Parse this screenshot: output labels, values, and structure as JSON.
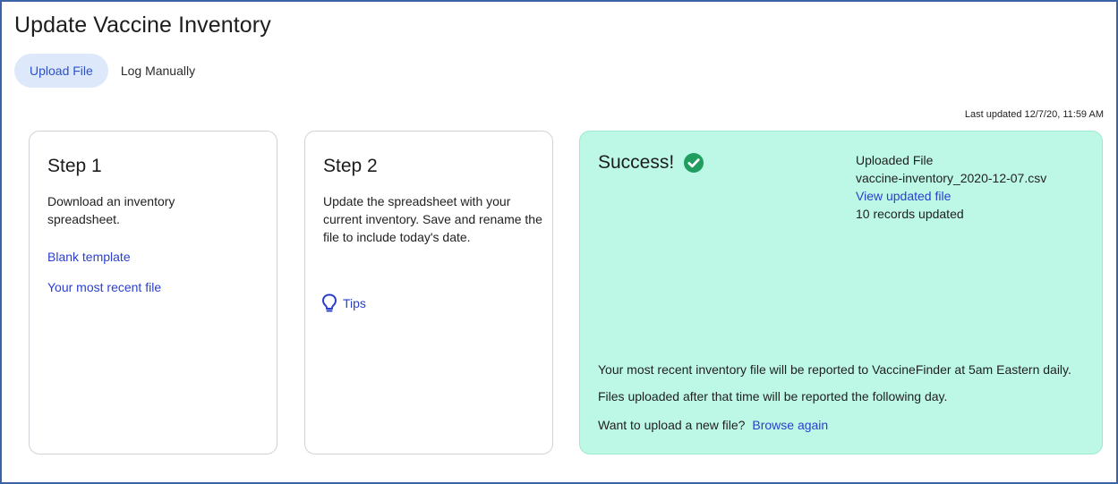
{
  "page": {
    "title": "Update Vaccine Inventory",
    "last_updated": "Last updated 12/7/20, 11:59 AM"
  },
  "tabs": [
    {
      "label": "Upload File",
      "active": true
    },
    {
      "label": "Log Manually",
      "active": false
    }
  ],
  "step1": {
    "title": "Step 1",
    "description": "Download an inventory spreadsheet.",
    "links": [
      "Blank template",
      "Your most recent file"
    ]
  },
  "step2": {
    "title": "Step 2",
    "description": "Update the spreadsheet with your current inventory. Save and rename the file to include today's date.",
    "tips_label": "Tips",
    "tips_icon": "lightbulb-icon"
  },
  "success": {
    "title": "Success!",
    "status_icon": "check-circle-icon",
    "file_heading": "Uploaded File",
    "file_name": "vaccine-inventory_2020-12-07.csv",
    "view_link": "View updated file",
    "records": "10 records updated",
    "report_note": "Your most recent inventory file will be reported to VaccineFinder at 5am Eastern daily. Files uploaded after that time will be reported the following day.",
    "upload_prompt": "Want to upload a new file?",
    "browse_link": "Browse again"
  },
  "colors": {
    "accent": "#2a3fcc",
    "active_tab_bg": "#dde8fb",
    "success_bg": "#bdf8e6",
    "success_icon": "#1f9e60",
    "frame_border": "#3b64a6"
  }
}
